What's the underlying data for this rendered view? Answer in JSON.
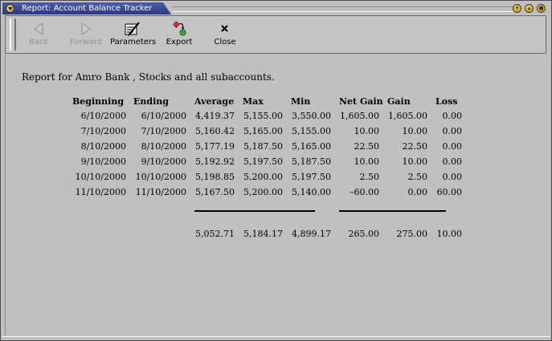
{
  "window": {
    "title": "Report: Account Balance Tracker"
  },
  "toolbar": {
    "buttons": [
      {
        "label": "Back",
        "icon": "back-arrow-icon",
        "enabled": false
      },
      {
        "label": "Forward",
        "icon": "forward-arrow-icon",
        "enabled": false
      },
      {
        "label": "Parameters",
        "icon": "parameters-icon",
        "enabled": true
      },
      {
        "label": "Export",
        "icon": "export-icon",
        "enabled": true
      },
      {
        "label": "Close",
        "icon": "close-icon",
        "enabled": true
      }
    ]
  },
  "report": {
    "heading": "Report for Amro Bank , Stocks and all subaccounts.",
    "columns": [
      "Beginning",
      "Ending",
      "Average",
      "Max",
      "Min",
      "Net Gain",
      "Gain",
      "Loss"
    ],
    "rows": [
      [
        "6/10/2000",
        "6/10/2000",
        "4,419.37",
        "5,155.00",
        "3,550.00",
        "1,605.00",
        "1,605.00",
        "0.00"
      ],
      [
        "7/10/2000",
        "7/10/2000",
        "5,160.42",
        "5,165.00",
        "5,155.00",
        "10.00",
        "10.00",
        "0.00"
      ],
      [
        "8/10/2000",
        "8/10/2000",
        "5,177.19",
        "5,187.50",
        "5,165.00",
        "22.50",
        "22.50",
        "0.00"
      ],
      [
        "9/10/2000",
        "9/10/2000",
        "5,192.92",
        "5,197.50",
        "5,187.50",
        "10.00",
        "10.00",
        "0.00"
      ],
      [
        "10/10/2000",
        "10/10/2000",
        "5,198.85",
        "5,200.00",
        "5,197.50",
        "2.50",
        "2.50",
        "0.00"
      ],
      [
        "11/10/2000",
        "11/10/2000",
        "5,167.50",
        "5,200.00",
        "5,140.00",
        "–60.00",
        "0.00",
        "60.00"
      ]
    ],
    "totals": [
      "5,052.71",
      "5,184.17",
      "4,899.17",
      "265.00",
      "275.00",
      "10.00"
    ]
  }
}
